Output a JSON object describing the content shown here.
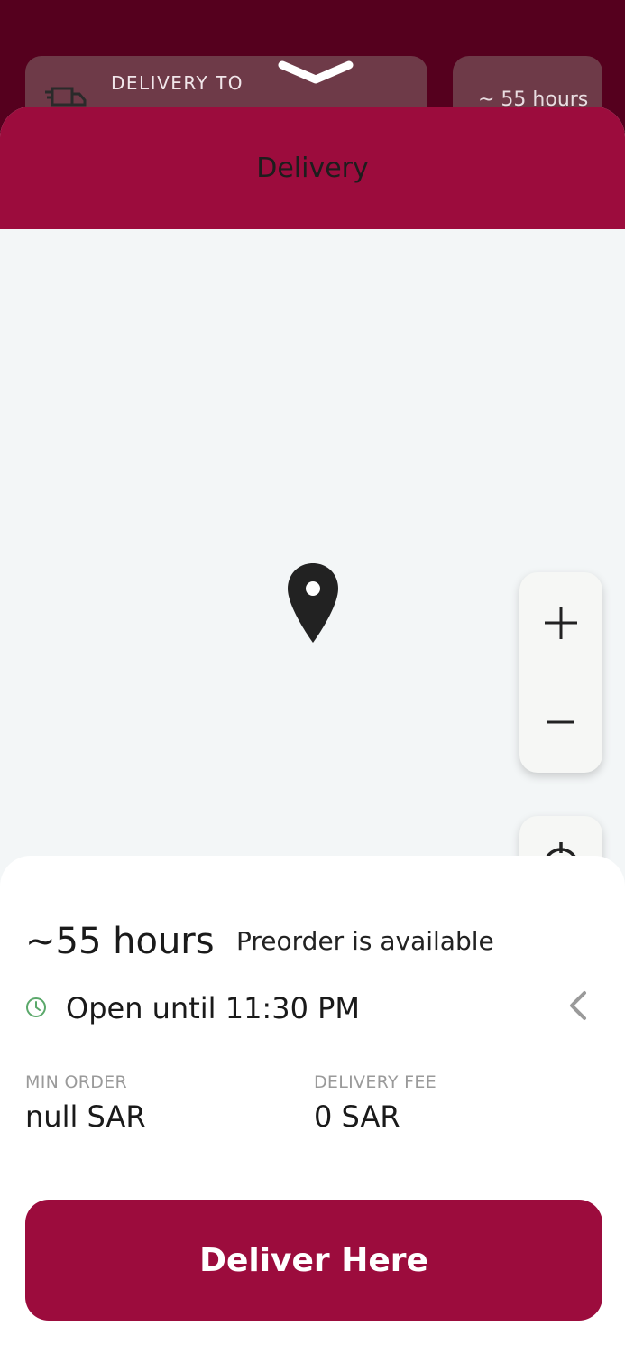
{
  "background_header": {
    "delivery_to_label": "DELIVERY TO",
    "eta_chip": "~ 55 hours"
  },
  "sheet": {
    "title": "Delivery"
  },
  "map": {
    "zoom_in_icon": "plus-icon",
    "zoom_out_icon": "minus-icon",
    "locate_icon": "crosshair-icon",
    "pin_icon": "map-pin-icon"
  },
  "info": {
    "eta": "~55 hours",
    "preorder": "Preorder is available",
    "open_until": "Open until 11:30 PM",
    "min_order_label": "MIN ORDER",
    "min_order_value": "null SAR",
    "delivery_fee_label": "DELIVERY FEE",
    "delivery_fee_value": "0 SAR"
  },
  "actions": {
    "deliver_here": "Deliver Here"
  },
  "colors": {
    "brand": "#9c0c3d",
    "header_dark": "#55001e",
    "open_clock": "#5aa86a"
  }
}
